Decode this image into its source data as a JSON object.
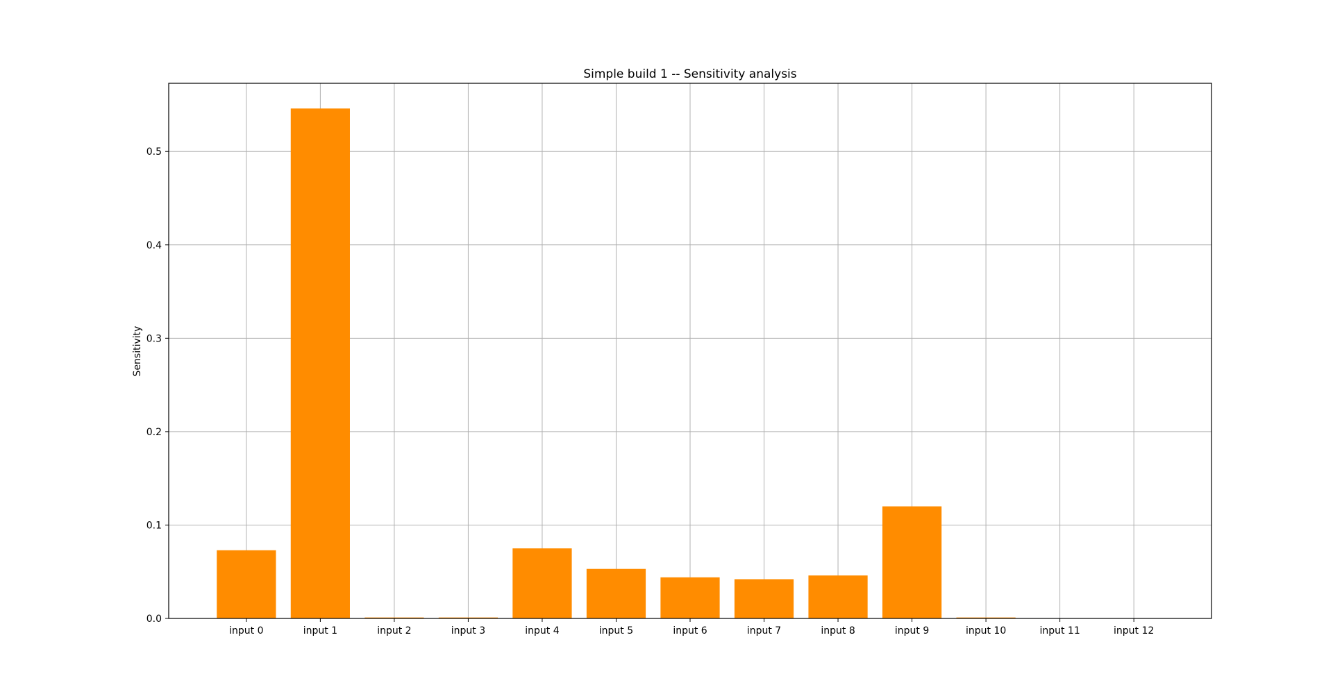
{
  "chart_data": {
    "type": "bar",
    "title": "Simple build 1 -- Sensitivity analysis",
    "xlabel": "",
    "ylabel": "Sensitivity",
    "categories": [
      "input 0",
      "input 1",
      "input 2",
      "input 3",
      "input 4",
      "input 5",
      "input 6",
      "input 7",
      "input 8",
      "input 9",
      "input 10",
      "input 11",
      "input 12"
    ],
    "values": [
      0.073,
      0.546,
      0.001,
      0.001,
      0.075,
      0.053,
      0.044,
      0.042,
      0.046,
      0.12,
      0.001,
      0.0,
      0.0
    ],
    "ylim": [
      0,
      0.573
    ],
    "yticks": [
      0.0,
      0.1,
      0.2,
      0.3,
      0.4,
      0.5
    ],
    "ytick_labels": [
      "0.0",
      "0.1",
      "0.2",
      "0.3",
      "0.4",
      "0.5"
    ],
    "grid": true,
    "bar_color": "#ff8c00",
    "grid_color": "#b0b0b0",
    "legend": "none"
  }
}
